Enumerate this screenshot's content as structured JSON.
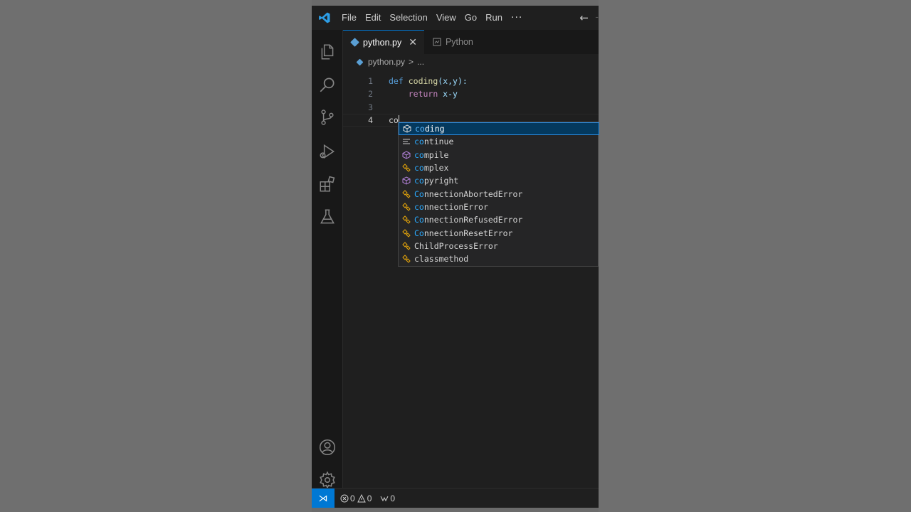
{
  "menu": {
    "items": [
      "File",
      "Edit",
      "Selection",
      "View",
      "Go",
      "Run"
    ],
    "more": "···"
  },
  "tabs": [
    {
      "label": "python.py",
      "active": true
    },
    {
      "label": "Python",
      "active": false
    }
  ],
  "breadcrumb": {
    "file": "python.py",
    "sep": ">",
    "rest": "..."
  },
  "editor": {
    "lines": [
      {
        "num": "1",
        "kw": "def",
        "fn": "coding",
        "rest": "(x,y):"
      },
      {
        "num": "2",
        "kw2": "return",
        "rest": " x-y"
      },
      {
        "num": "3"
      },
      {
        "num": "4",
        "typed": "co"
      }
    ]
  },
  "suggestions": [
    {
      "match": "co",
      "rest": "ding",
      "icon": "cube-icon",
      "selected": true
    },
    {
      "match": "co",
      "rest": "ntinue",
      "icon": "keyword-icon"
    },
    {
      "match": "co",
      "rest": "mpile",
      "icon": "cube-icon"
    },
    {
      "match": "co",
      "rest": "mplex",
      "icon": "class-icon"
    },
    {
      "match": "co",
      "rest": "pyright",
      "icon": "cube-icon"
    },
    {
      "match": "Co",
      "rest": "nnectionAbortedError",
      "icon": "class-icon"
    },
    {
      "match": "co",
      "rest": "nnectionError",
      "icon": "class-icon"
    },
    {
      "match": "Co",
      "rest": "nnectionRefusedError",
      "icon": "class-icon"
    },
    {
      "match": "Co",
      "rest": "nnectionResetError",
      "icon": "class-icon"
    },
    {
      "match": "",
      "rest": "ChildProcessError",
      "icon": "class-icon"
    },
    {
      "match": "",
      "rest": "classmethod",
      "icon": "class-icon"
    }
  ],
  "status": {
    "errors": "0",
    "warnings": "0",
    "ports": "0"
  },
  "colors": {
    "accent": "#0078d4",
    "class_icon": "#e5a50a",
    "cube_icon": "#b180d7"
  }
}
